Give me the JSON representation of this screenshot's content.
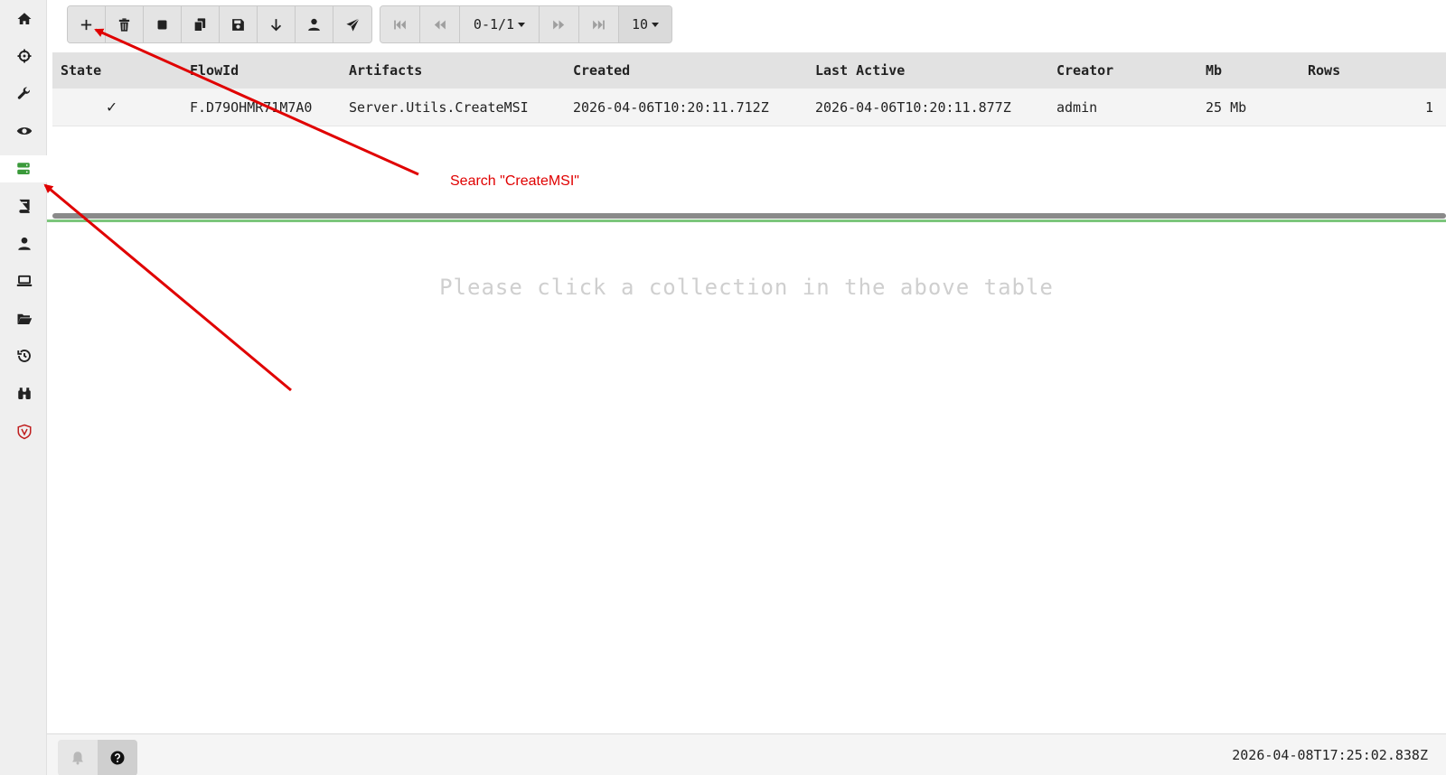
{
  "sidebar": {
    "items": [
      {
        "name": "home-icon"
      },
      {
        "name": "crosshair-icon"
      },
      {
        "name": "wrench-icon"
      },
      {
        "name": "eye-icon"
      },
      {
        "name": "server-icon",
        "active": true
      },
      {
        "name": "book-icon"
      },
      {
        "name": "user-icon"
      },
      {
        "name": "laptop-icon"
      },
      {
        "name": "folder-open-icon"
      },
      {
        "name": "history-icon"
      },
      {
        "name": "binoculars-icon"
      },
      {
        "name": "velociraptor-logo-icon"
      }
    ],
    "active_color": "#3a9a3a"
  },
  "toolbar": {
    "buttons": [
      "plus-icon",
      "trash-icon",
      "stop-icon",
      "copy-icon",
      "save-icon",
      "download-icon",
      "user-icon",
      "send-icon"
    ],
    "pager": {
      "page_label": "0-1/1",
      "page_size": "10"
    }
  },
  "table": {
    "columns": [
      "State",
      "FlowId",
      "Artifacts",
      "Created",
      "Last Active",
      "Creator",
      "Mb",
      "Rows"
    ],
    "rows": [
      {
        "state": "✓",
        "flow_id": "F.D79OHMR71M7A0",
        "artifacts": "Server.Utils.CreateMSI",
        "created": "2026-04-06T10:20:11.712Z",
        "last_active": "2026-04-06T10:20:11.877Z",
        "creator": "admin",
        "mb": "25 Mb",
        "rows": "1"
      }
    ]
  },
  "detail": {
    "placeholder": "Please click a collection in the above table"
  },
  "annotation": {
    "text": "Search \"CreateMSI\"",
    "color": "#e00000"
  },
  "footer": {
    "clock": "2026-04-08T17:25:02.838Z"
  }
}
